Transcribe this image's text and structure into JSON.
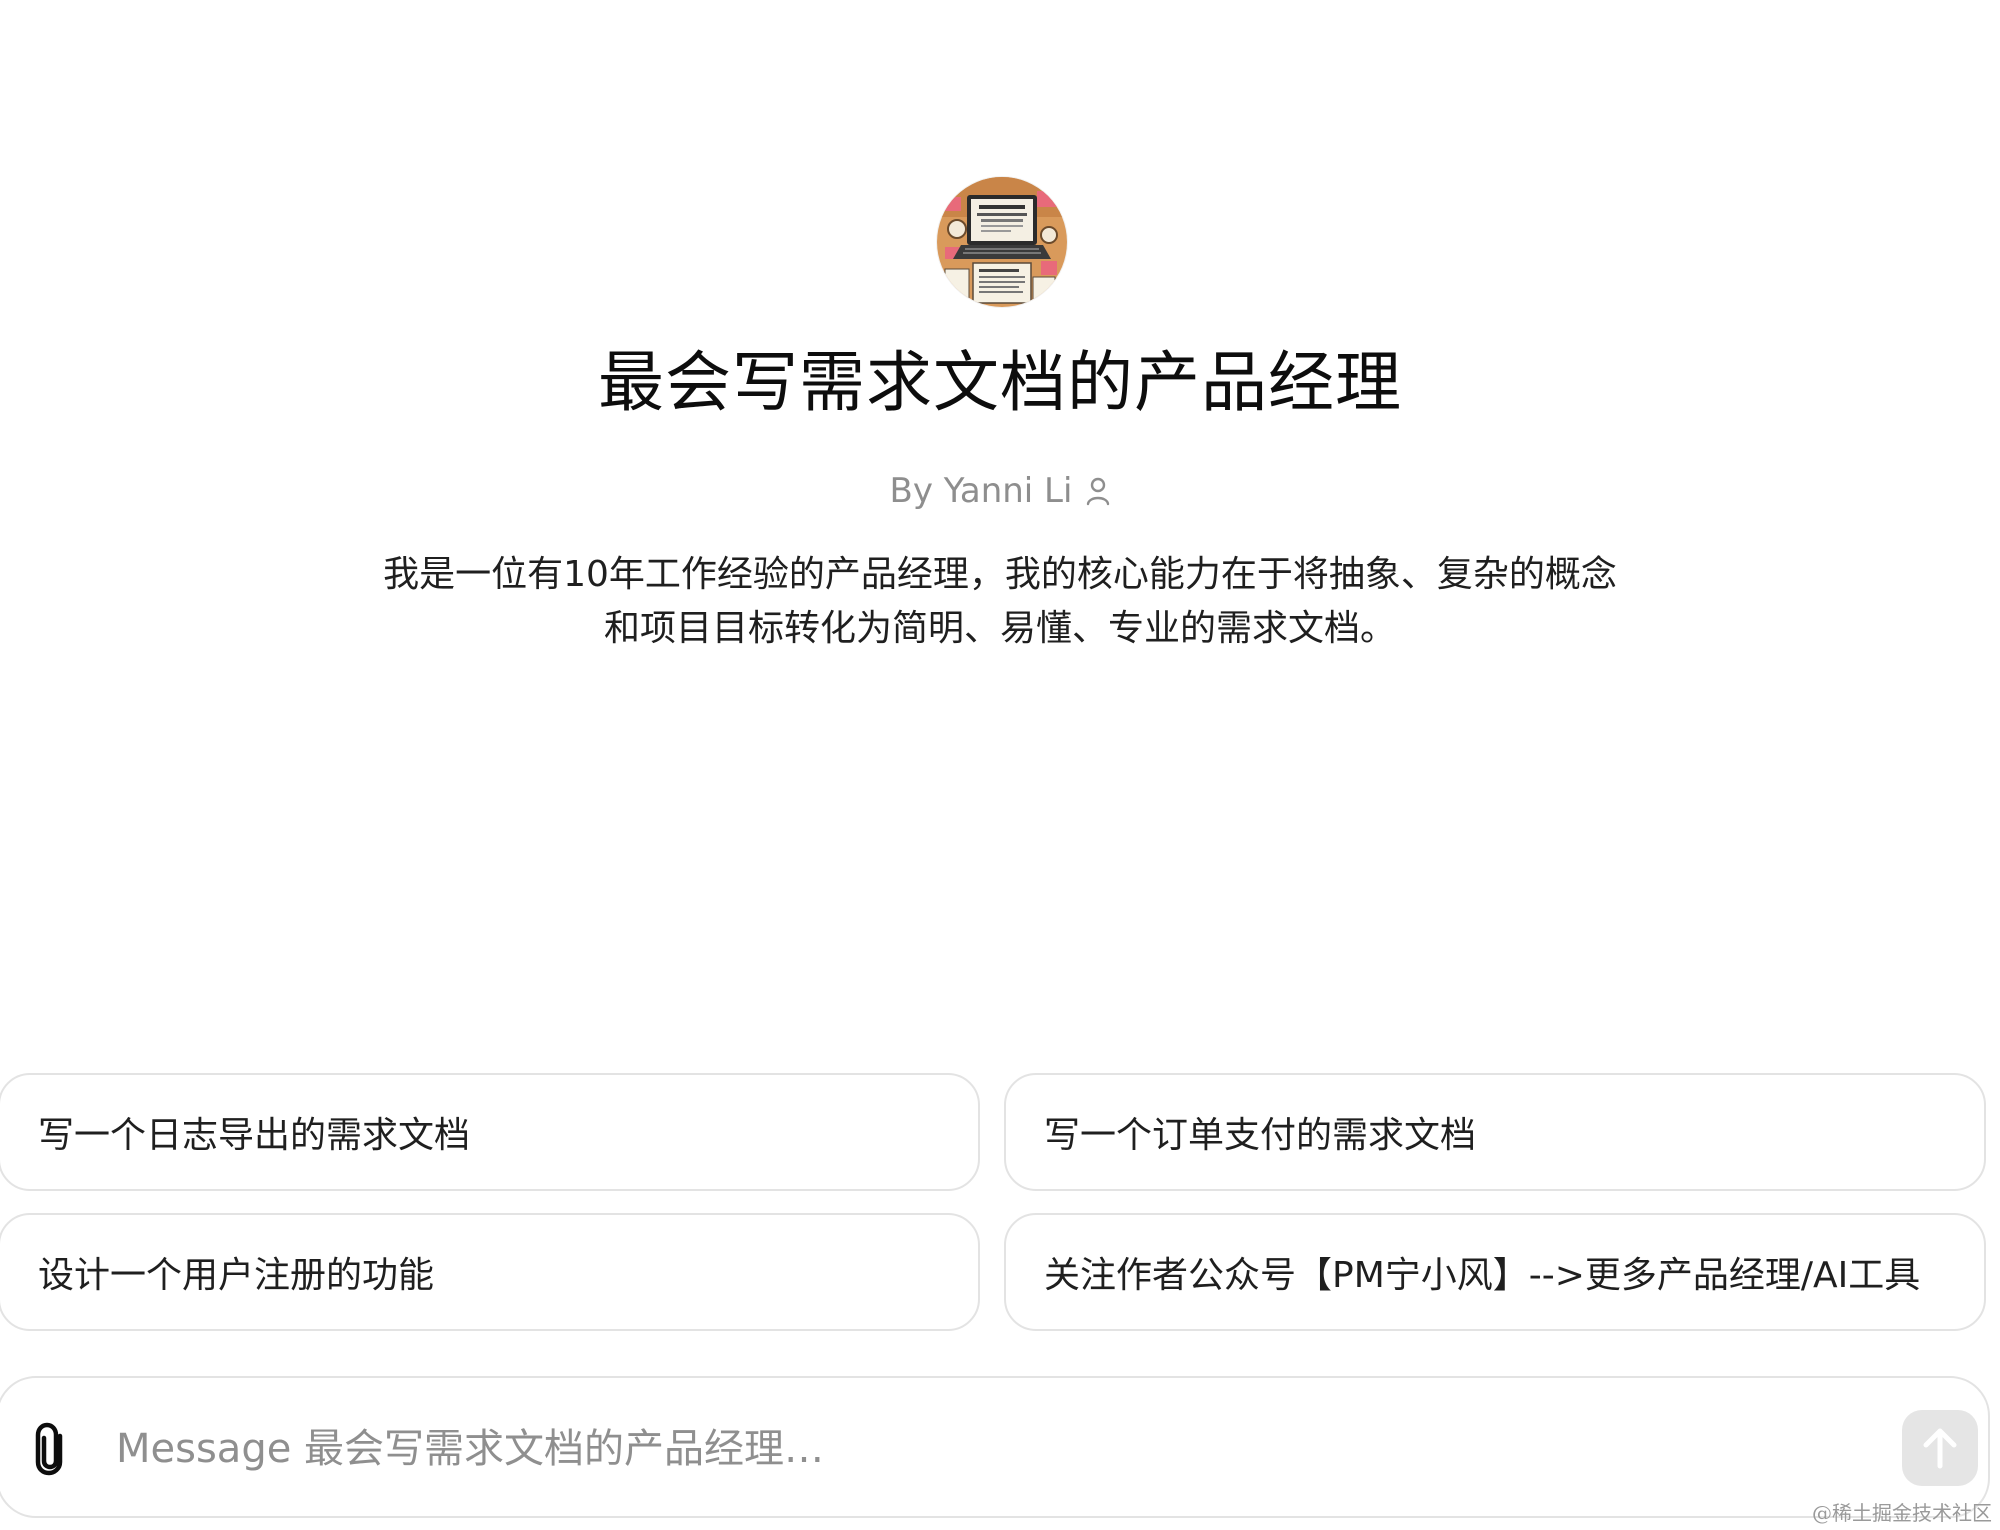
{
  "gpt": {
    "avatar_icon": "laptop-desk-illustration",
    "title": "最会写需求文档的产品经理",
    "author": "By Yanni Li",
    "author_icon": "person-icon",
    "description": "我是一位有10年工作经验的产品经理，我的核心能力在于将抽象、复杂的概念和项目目标转化为简明、易懂、专业的需求文档。"
  },
  "suggestions": [
    {
      "label": "写一个日志导出的需求文档"
    },
    {
      "label": "写一个订单支付的需求文档"
    },
    {
      "label": "设计一个用户注册的功能"
    },
    {
      "label": "关注作者公众号【PM宁小风】-->更多产品经理/AI工具"
    }
  ],
  "composer": {
    "value": "",
    "placeholder": "Message 最会写需求文档的产品经理…",
    "attach_icon": "paperclip-icon",
    "send_icon": "arrow-up-icon"
  },
  "watermark": "@稀土掘金技术社区",
  "colors": {
    "background": "#ffffff",
    "card_border": "#e3e3e3",
    "muted_text": "#8e8e8e",
    "send_button_disabled": "#e5e5e5"
  }
}
